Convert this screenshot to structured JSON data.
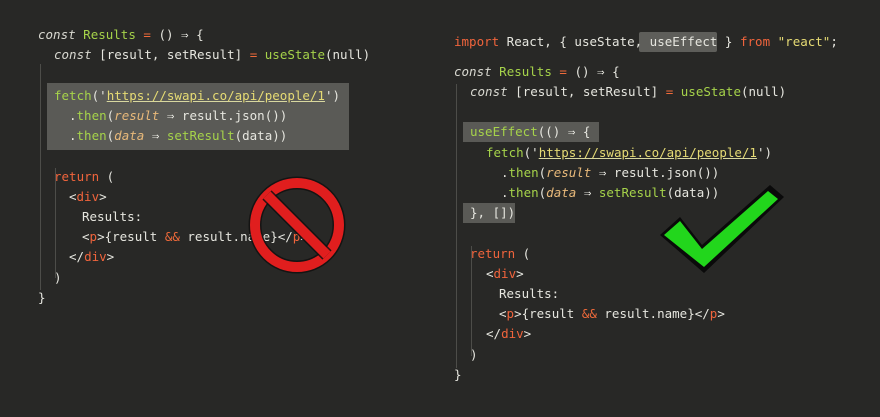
{
  "left": {
    "line1": {
      "kw": "const",
      "name": "Results",
      "eq": "=",
      "arrow": "() ⇒ {"
    },
    "line2": {
      "kw": "const",
      "body": "[result, setResult]",
      "eq": "=",
      "fn": "useState",
      "arg": "(null)"
    },
    "fetch": {
      "fn": "fetch",
      "open": "('",
      "url": "https://swapi.co/api/people/1",
      "close": "')"
    },
    "then1": {
      "dot": ".",
      "fn": "then",
      "open": "(",
      "param": "result",
      "arrow": "⇒",
      "body": "result.json())"
    },
    "then2": {
      "dot": ".",
      "fn": "then",
      "open": "(",
      "param": "data",
      "arrow": "⇒",
      "fn2": "setResult",
      "body": "(data))"
    },
    "ret": {
      "kw": "return",
      "rest": " ("
    },
    "div_open": {
      "lt": "<",
      "tag": "div",
      "gt": ">"
    },
    "results": "Results:",
    "p_line": {
      "lt": "<",
      "tag": "p",
      "gt": ">",
      "expr": "{result",
      "amp": "&&",
      "expr2": "result.name}",
      "close_lt": "</",
      "close_tag": "p",
      "close_gt": ">"
    },
    "div_close": {
      "lt": "</",
      "tag": "div",
      "gt": ">"
    },
    "paren": ")",
    "brace": "}"
  },
  "right": {
    "import": {
      "kw": "import",
      "name": " React, { useState, ",
      "hl": "useEffect",
      "rest": " }",
      "from": "from",
      "str": "\"react\"",
      "semi": ";"
    },
    "line1": {
      "kw": "const",
      "name": "Results",
      "eq": "=",
      "arrow": "() ⇒ {"
    },
    "line2": {
      "kw": "const",
      "body": "[result, setResult]",
      "eq": "=",
      "fn": "useState",
      "arg": "(null)"
    },
    "effect": {
      "fn": "useEffect",
      "rest": "(() ⇒ {"
    },
    "fetch": {
      "fn": "fetch",
      "open": "('",
      "url": "https://swapi.co/api/people/1",
      "close": "')"
    },
    "then1": {
      "dot": ".",
      "fn": "then",
      "open": "(",
      "param": "result",
      "arrow": "⇒",
      "body": "result.json())"
    },
    "then2": {
      "dot": ".",
      "fn": "then",
      "open": "(",
      "param": "data",
      "arrow": "⇒",
      "fn2": "setResult",
      "body": "(data))"
    },
    "effect_close": "}, [])",
    "ret": {
      "kw": "return",
      "rest": " ("
    },
    "div_open": {
      "lt": "<",
      "tag": "div",
      "gt": ">"
    },
    "results": "Results:",
    "p_line": {
      "lt": "<",
      "tag": "p",
      "gt": ">",
      "expr": "{result",
      "amp": "&&",
      "expr2": "result.name}",
      "close_lt": "</",
      "close_tag": "p",
      "close_gt": ">"
    },
    "div_close": {
      "lt": "</",
      "tag": "div",
      "gt": ">"
    },
    "paren": ")",
    "brace": "}"
  },
  "icons": {
    "prohibited": "prohibited-icon",
    "check": "checkmark-icon"
  },
  "colors": {
    "background": "#282826",
    "keyword": "#f0643c",
    "function": "#a6d34a",
    "string": "#e6db74",
    "highlight": "#5a5a56",
    "prohibited": "#e01e1e",
    "check": "#22d61c"
  }
}
